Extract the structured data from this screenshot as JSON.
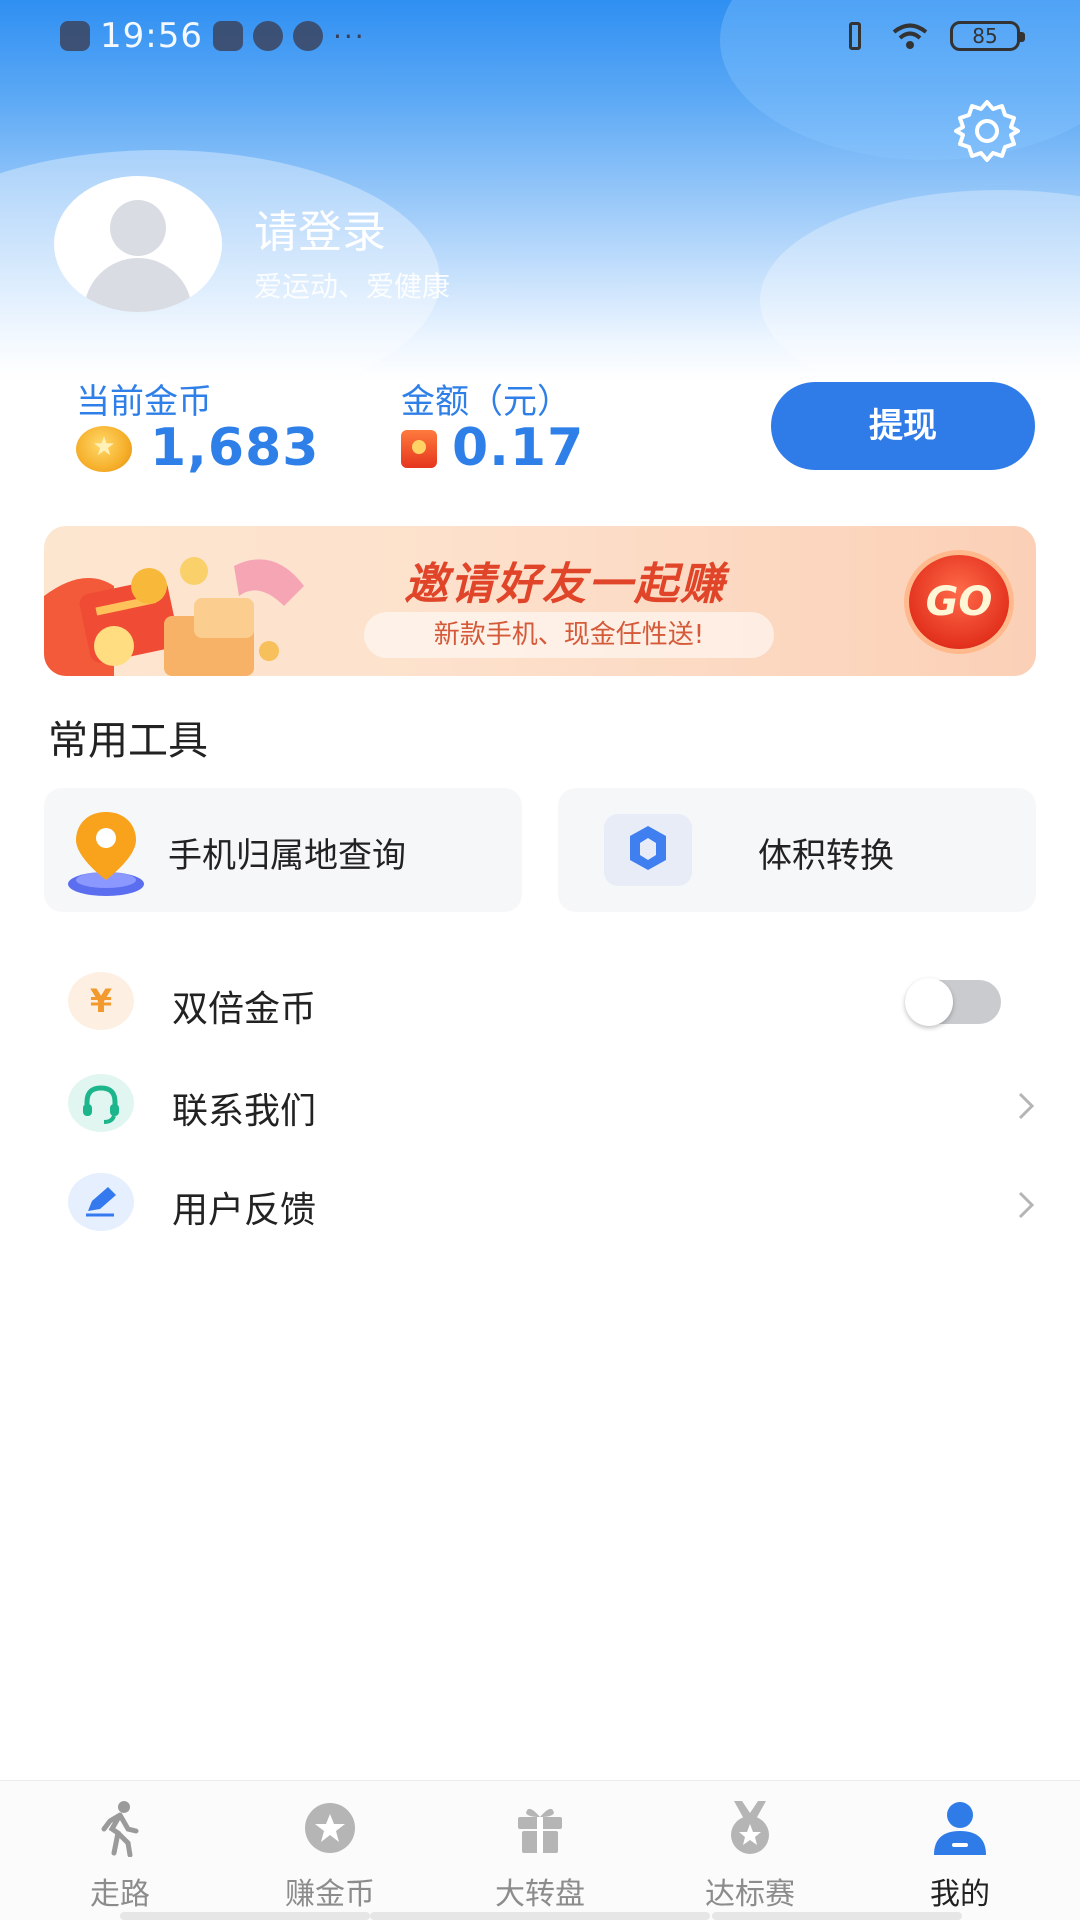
{
  "status_bar": {
    "time": "19:56",
    "extra": "···",
    "battery": "85"
  },
  "profile": {
    "title": "请登录",
    "subtitle": "爱运动、爱健康",
    "settings_icon": "gear-icon"
  },
  "balance": {
    "coins_label": "当前金币",
    "coins_value": "1,683",
    "amount_label": "金额（元）",
    "amount_value": "0.17",
    "withdraw_label": "提现"
  },
  "banner": {
    "title": "邀请好友一起赚",
    "subtitle": "新款手机、现金任性送!",
    "go_label": "GO"
  },
  "tools": {
    "section_title": "常用工具",
    "items": [
      {
        "label": "手机归属地查询",
        "icon": "location-pin-icon"
      },
      {
        "label": "体积转换",
        "icon": "hexagon-icon"
      }
    ]
  },
  "settings_list": [
    {
      "label": "双倍金币",
      "icon": "yen-icon",
      "control": "toggle",
      "toggle_on": false
    },
    {
      "label": "联系我们",
      "icon": "headset-icon",
      "control": "chevron"
    },
    {
      "label": "用户反馈",
      "icon": "pencil-icon",
      "control": "chevron"
    }
  ],
  "nav": {
    "items": [
      {
        "label": "走路",
        "icon": "walk-icon"
      },
      {
        "label": "赚金币",
        "icon": "star-coin-icon"
      },
      {
        "label": "大转盘",
        "icon": "gift-icon"
      },
      {
        "label": "达标赛",
        "icon": "medal-icon"
      },
      {
        "label": "我的",
        "icon": "user-icon",
        "active": true
      }
    ]
  },
  "colors": {
    "accent": "#2f7be8",
    "header_top": "#2f8ff2",
    "banner_text": "#e0452a"
  }
}
